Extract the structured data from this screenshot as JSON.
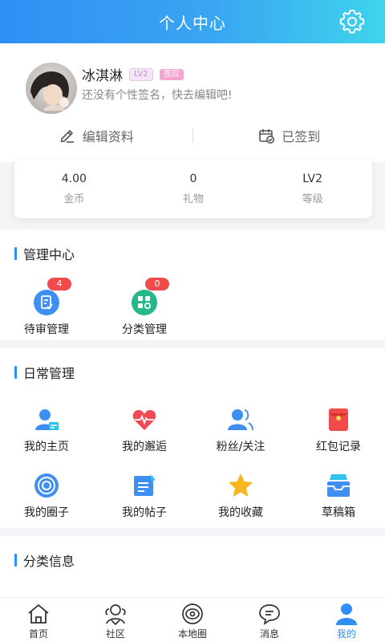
{
  "header": {
    "title": "个人中心",
    "settings_icon": "gear-icon"
  },
  "profile": {
    "username": "冰淇淋",
    "level_tag": "LV2",
    "sign_tag": "签应",
    "signature": "还没有个性签名，快去编辑吧!",
    "edit_label": "编辑资料",
    "checkin_label": "已签到"
  },
  "stats": [
    {
      "value": "4.00",
      "label": "金币"
    },
    {
      "value": "0",
      "label": "礼物"
    },
    {
      "value": "LV2",
      "label": "等级"
    }
  ],
  "management": {
    "title": "管理中心",
    "items": [
      {
        "label": "待审管理",
        "badge": "4",
        "icon": "review-doc-icon"
      },
      {
        "label": "分类管理",
        "badge": "0",
        "icon": "category-settings-icon"
      }
    ]
  },
  "daily": {
    "title": "日常管理",
    "items": [
      {
        "label": "我的主页",
        "icon": "user-card-icon"
      },
      {
        "label": "我的邂逅",
        "icon": "heart-pulse-icon"
      },
      {
        "label": "粉丝/关注",
        "icon": "users-icon"
      },
      {
        "label": "红包记录",
        "icon": "red-envelope-icon"
      },
      {
        "label": "我的圈子",
        "icon": "circle-target-icon"
      },
      {
        "label": "我的帖子",
        "icon": "post-edit-icon"
      },
      {
        "label": "我的收藏",
        "icon": "star-icon"
      },
      {
        "label": "草稿箱",
        "icon": "inbox-tray-icon"
      }
    ]
  },
  "category": {
    "title": "分类信息"
  },
  "tabbar": [
    {
      "label": "首页",
      "icon": "home-icon",
      "active": false
    },
    {
      "label": "社区",
      "icon": "community-icon",
      "active": false
    },
    {
      "label": "本地圈",
      "icon": "local-circle-icon",
      "active": false
    },
    {
      "label": "消息",
      "icon": "message-icon",
      "active": false
    },
    {
      "label": "我的",
      "icon": "profile-icon",
      "active": true
    }
  ],
  "colors": {
    "primary": "#2f8ff4",
    "badge_red": "#f04a4a",
    "badge_green": "#f04a4a"
  }
}
